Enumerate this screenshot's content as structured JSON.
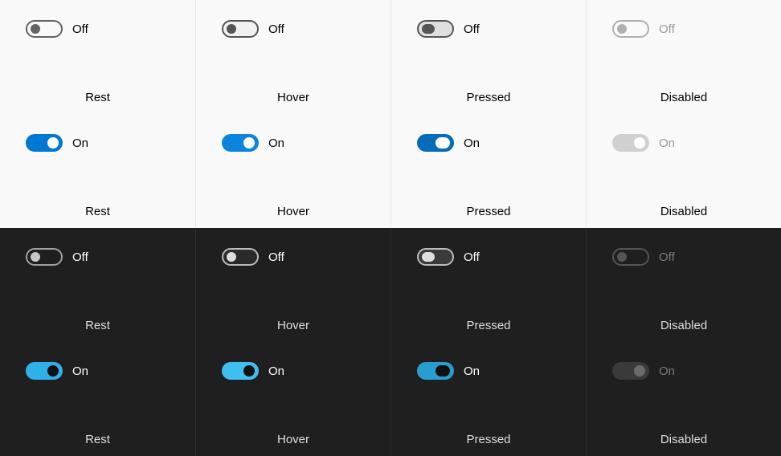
{
  "labels": {
    "off": "Off",
    "on": "On"
  },
  "states": {
    "rest": "Rest",
    "hover": "Hover",
    "pressed": "Pressed",
    "disabled": "Disabled"
  },
  "rows": [
    {
      "theme": "light",
      "value": "off",
      "label_key": "off",
      "interactable_last": false
    },
    {
      "theme": "light",
      "value": "on",
      "label_key": "on",
      "interactable_last": false
    },
    {
      "theme": "dark",
      "value": "off",
      "label_key": "off",
      "interactable_last": false
    },
    {
      "theme": "dark",
      "value": "on",
      "label_key": "on",
      "interactable_last": false
    }
  ],
  "columns": [
    "rest",
    "hover",
    "pressed",
    "disabled"
  ]
}
